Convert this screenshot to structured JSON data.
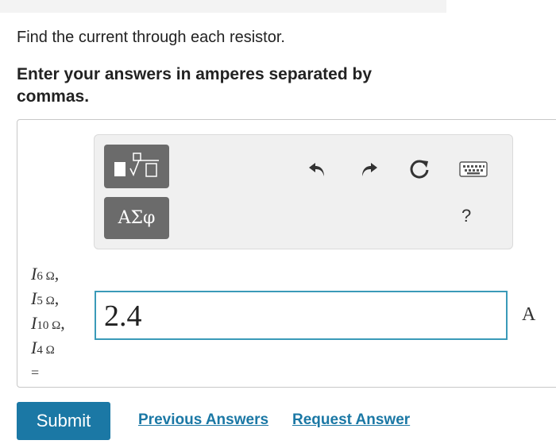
{
  "question_text": "Find the current through each resistor.",
  "instruction_text": "Enter your answers in amperes separated by commas.",
  "toolbar": {
    "greek_label": "ΑΣφ",
    "help_label": "?",
    "icons": [
      "templates-icon",
      "undo-icon",
      "redo-icon",
      "reset-icon",
      "keyboard-icon"
    ]
  },
  "variables": [
    {
      "symbol": "I",
      "sub": "6 Ω",
      "sep": ","
    },
    {
      "symbol": "I",
      "sub": "5 Ω",
      "sep": ","
    },
    {
      "symbol": "I",
      "sub": "10 Ω",
      "sep": ","
    },
    {
      "symbol": "I",
      "sub": "4 Ω",
      "sep": ""
    }
  ],
  "equals": "=",
  "answer_value": "2.4",
  "unit": "A",
  "buttons": {
    "submit": "Submit",
    "previous_answers": "Previous Answers",
    "request_answer": "Request Answer"
  },
  "colors": {
    "accent": "#1b78a5",
    "input_border": "#3a9ab8",
    "tool_button": "#6b6b6b"
  }
}
